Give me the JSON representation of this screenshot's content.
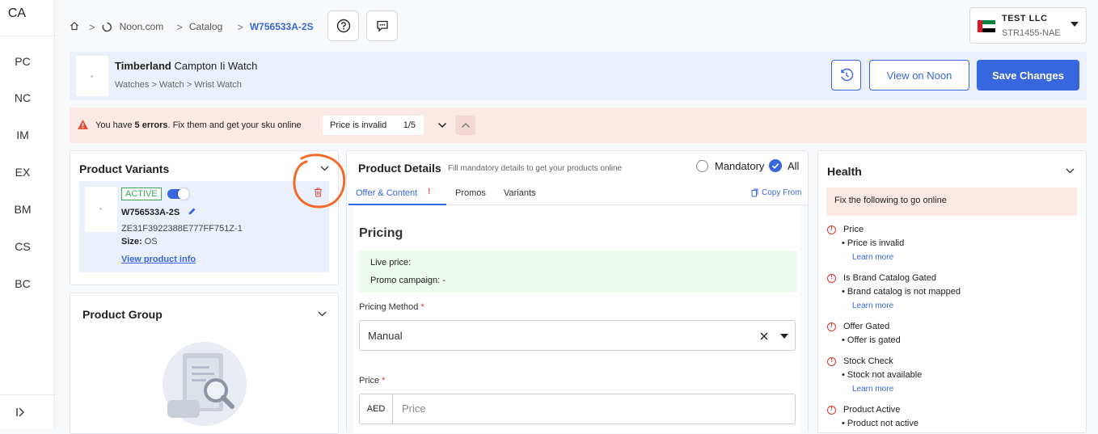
{
  "sidebar": {
    "top": "CA",
    "items": [
      "PC",
      "NC",
      "IM",
      "EX",
      "BM",
      "CS",
      "BC"
    ],
    "collapse_glyph": "K"
  },
  "breadcrumb": {
    "items": [
      "Noon.com",
      "Catalog",
      "W756533A-2S"
    ],
    "separator": ">"
  },
  "store": {
    "name": "TEST LLC",
    "code": "STR1455-NAE"
  },
  "product": {
    "brand": "Timberland",
    "name": "Campton Ii Watch",
    "categories": "Watches > Watch > Wrist Watch",
    "view_label": "View on Noon",
    "save_label": "Save Changes"
  },
  "errors": {
    "prefix": "You have",
    "count": "5 errors",
    "suffix": ". Fix them and get your sku online",
    "current_error": "Price is invalid",
    "position": "1/5"
  },
  "variants": {
    "title": "Product Variants",
    "status": "ACTIVE",
    "sku": "W756533A-2S",
    "code": "ZE31F3922388E777FF751Z-1",
    "size_label": "Size:",
    "size_value": "OS",
    "link": "View product info"
  },
  "group": {
    "title": "Product Group"
  },
  "details": {
    "title": "Product Details",
    "subtitle": "Fill mandatory details to get your products online",
    "filter_mandatory": "Mandatory",
    "filter_all": "All",
    "tabs": [
      "Offer & Content",
      "Promos",
      "Variants"
    ],
    "copy_from": "Copy From",
    "section": "Pricing",
    "live_price": "Live price:",
    "promo_campaign": "Promo campaign: -",
    "pricing_method_label": "Pricing Method",
    "pricing_method_value": "Manual",
    "price_label": "Price",
    "currency": "AED",
    "price_placeholder": "Price",
    "required_mark": "*"
  },
  "health": {
    "title": "Health",
    "banner": "Fix the following to go online",
    "learn_more": "Learn more",
    "checks": [
      {
        "name": "Price",
        "issue": "Price is invalid"
      },
      {
        "name": "Is Brand Catalog Gated",
        "issue": "Brand catalog is not mapped"
      },
      {
        "name": "Offer Gated",
        "issue": "Offer is gated"
      },
      {
        "name": "Stock Check",
        "issue": "Stock not available"
      },
      {
        "name": "Product Active",
        "issue": "Product not active"
      }
    ]
  },
  "colors": {
    "primary": "#3866df",
    "error_bg": "#fbe9e5",
    "highlight_bg": "#eaf0fc",
    "annotation": "#f26a2a"
  }
}
